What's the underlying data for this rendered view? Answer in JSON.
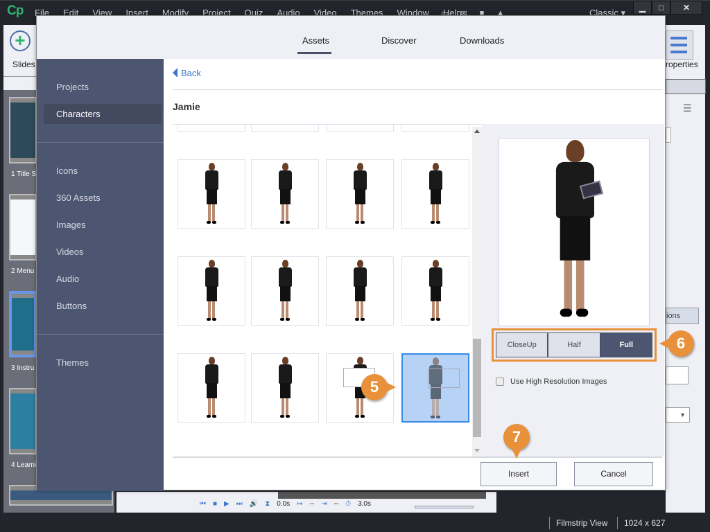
{
  "app": {
    "logo": "Cp",
    "menu": [
      "File",
      "Edit",
      "View",
      "Insert",
      "Modify",
      "Project",
      "Quiz",
      "Audio",
      "Video",
      "Themes",
      "Window",
      "Help"
    ],
    "workspace": "Classic",
    "window_controls": {
      "minimize": "▁",
      "maximize": "□",
      "close": "✕"
    }
  },
  "left_toolbar": {
    "slides_label": "Slides"
  },
  "filmstrip": {
    "slides": [
      {
        "label": "1 Title S",
        "color": "#2d4a5a"
      },
      {
        "label": "2 Menu",
        "color": "#f4f8fb"
      },
      {
        "label": "3 Instru",
        "color": "#1f6e8a",
        "selected": true
      },
      {
        "label": "4 Learni",
        "color": "#2c7fa0"
      }
    ]
  },
  "right_panel": {
    "properties_label": "roperties",
    "options_label": "ions"
  },
  "timeline": {
    "start_time": "0.0s",
    "in_point": "--",
    "out_point": "--",
    "duration": "3.0s"
  },
  "status_bar": {
    "view": "Filmstrip View",
    "resolution": "1024 x 627"
  },
  "dialog": {
    "tabs": [
      {
        "label": "Assets",
        "active": true
      },
      {
        "label": "Discover"
      },
      {
        "label": "Downloads"
      }
    ],
    "sidebar": {
      "group1": [
        "Projects",
        "Characters"
      ],
      "group2": [
        "Icons",
        "360 Assets",
        "Images",
        "Videos",
        "Audio",
        "Buttons"
      ],
      "group3": [
        "Themes"
      ],
      "selected": "Characters"
    },
    "back_label": "Back",
    "character_name": "Jamie",
    "grid": {
      "rows": [
        [
          "pose-arms-down",
          "pose-hand-on-hip",
          "pose-hands-on-hips",
          "pose-hand-to-face"
        ],
        [
          "pose-finger-raised",
          "pose-hand-wave",
          "pose-hand-raised",
          "pose-finger-up"
        ],
        [
          "pose-back-hands-hips",
          "pose-back-hands-clasped",
          "pose-holding-board",
          "pose-holding-board-side"
        ]
      ],
      "selected_index": 11
    },
    "view_modes": [
      {
        "label": "CloseUp"
      },
      {
        "label": "Half"
      },
      {
        "label": "Full",
        "active": true
      }
    ],
    "hires_label": "Use High Resolution Images",
    "hires_checked": false,
    "insert_label": "Insert",
    "cancel_label": "Cancel"
  },
  "callouts": {
    "step5": "5",
    "step6": "6",
    "step7": "7",
    "color": "#e8903a"
  }
}
